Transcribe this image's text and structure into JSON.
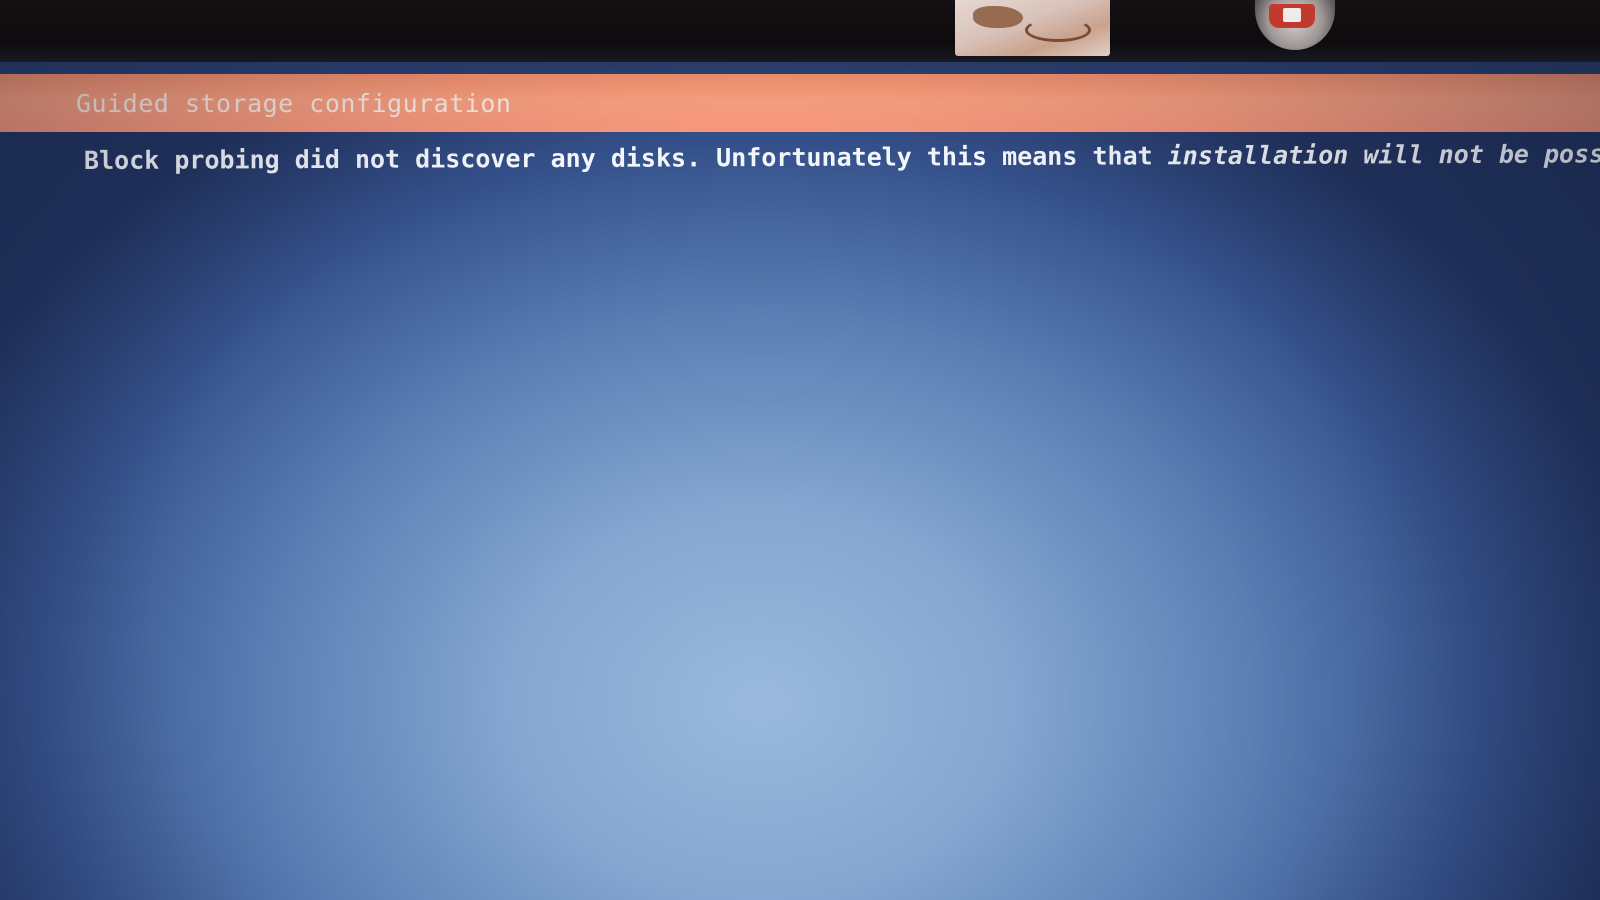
{
  "window": {
    "title": "Guided storage configuration"
  },
  "main": {
    "message_part1": "Block probing did not discover any disks. Unfortunately this means that ",
    "message_part2": "installation will not be possible."
  },
  "colors": {
    "title_bar": "#f9a07f",
    "title_text": "#fbe9e2",
    "screen_background": "#2b3f70",
    "message_text": "#f3f6fb"
  }
}
